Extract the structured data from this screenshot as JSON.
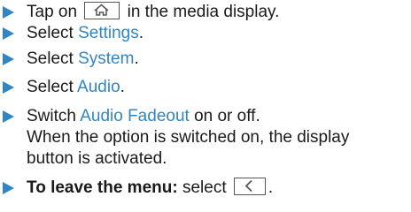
{
  "steps": [
    {
      "before": "Tap on",
      "icon": "home-icon",
      "after": "in the media display."
    },
    {
      "prefix": "Select ",
      "keyword": "Settings",
      "suffix": "."
    },
    {
      "prefix": "Select ",
      "keyword": "System",
      "suffix": "."
    },
    {
      "prefix": "Select ",
      "keyword": "Audio",
      "suffix": "."
    },
    {
      "prefix": "Switch ",
      "keyword": "Audio Fadeout",
      "suffix": " on or off.",
      "note_line1": "When the option is switched on, the display",
      "note_line2": "button is activated."
    },
    {
      "bold": "To leave the menu:",
      "text": "select",
      "icon": "back-icon",
      "suffix": "."
    }
  ],
  "colors": {
    "accent": "#2f86c6",
    "text": "#1a1a1a"
  }
}
